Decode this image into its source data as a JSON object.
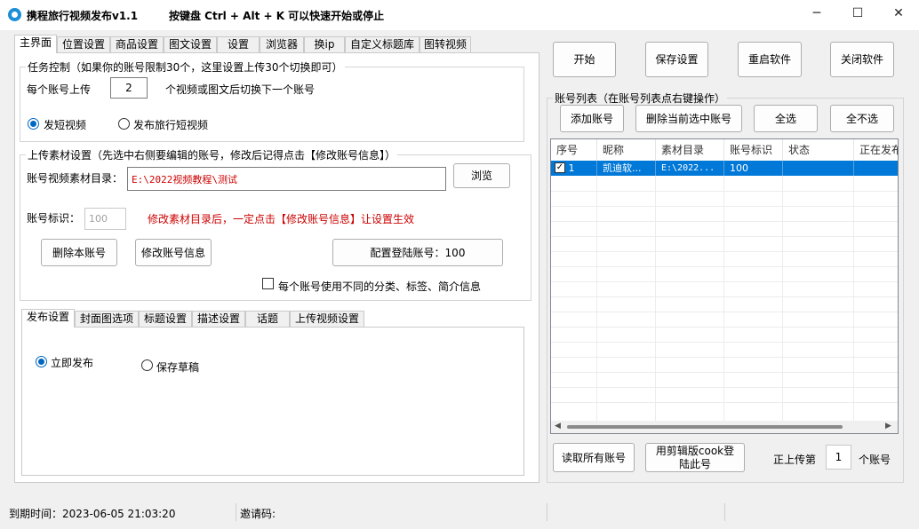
{
  "window": {
    "title": "携程旅行视频发布v1.1",
    "hotkey_hint": "按键盘 Ctrl + Alt + K  可以快速开始或停止",
    "minimize": "─",
    "maximize": "☐",
    "close": "✕"
  },
  "main_tabs": [
    "主界面",
    "位置设置",
    "商品设置",
    "图文设置",
    "设置",
    "浏览器",
    "换ip",
    "自定义标题库",
    "图转视频"
  ],
  "task_control": {
    "title": "任务控制（如果你的账号限制30个，这里设置上传30个切换即可）",
    "per_account_label": "每个账号上传",
    "per_account_value": "2",
    "per_account_suffix": "个视频或图文后切换下一个账号",
    "radio_short": "发短视频",
    "radio_travel": "发布旅行短视频"
  },
  "upload_settings": {
    "title": "上传素材设置（先选中右侧要编辑的账号，修改后记得点击【修改账号信息】）",
    "dir_label": "账号视频素材目录：",
    "dir_value": "E:\\2022视频教程\\测试",
    "browse": "浏览",
    "id_label": "账号标识：",
    "id_value": "100",
    "warning": "修改素材目录后，一定点击【修改账号信息】让设置生效",
    "delete_btn": "删除本账号",
    "modify_btn": "修改账号信息",
    "login_btn": "配置登陆账号：100",
    "diff_check": "每个账号使用不同的分类、标签、简介信息"
  },
  "publish_tabs": [
    "发布设置",
    "封面图选项",
    "标题设置",
    "描述设置",
    "话题",
    "上传视频设置"
  ],
  "publish": {
    "now": "立即发布",
    "draft": "保存草稿"
  },
  "top_buttons": {
    "start": "开始",
    "save": "保存设置",
    "restart": "重启软件",
    "close_app": "关闭软件"
  },
  "accounts": {
    "title": "账号列表（在账号列表点右键操作）",
    "add": "添加账号",
    "delete_selected": "删除当前选中账号",
    "select_all": "全选",
    "select_none": "全不选",
    "columns": [
      "序号",
      "昵称",
      "素材目录",
      "账号标识",
      "状态",
      "正在发布"
    ],
    "rows": [
      {
        "index": "1",
        "nickname": "凯迪软...",
        "dir": "E:\\2022...",
        "id": "100",
        "status": "",
        "publishing": ""
      }
    ],
    "read_all": "读取所有账号",
    "cook_login": "用剪辑版cook登陆此号",
    "uploading_label": "正上传第",
    "uploading_value": "1",
    "uploading_suffix": "个账号"
  },
  "status_bar": {
    "expire": "到期时间：2023-06-05 21:03:20",
    "invite": "邀请码:"
  },
  "colors": {
    "accent": "#0067c0",
    "selected_row": "#0078d7",
    "warning_text": "#cc0000"
  }
}
